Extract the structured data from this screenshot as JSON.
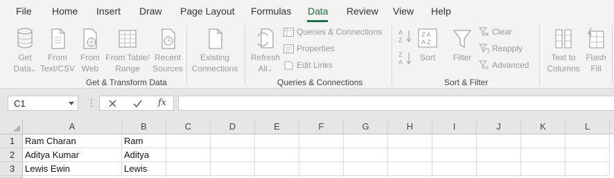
{
  "menu": {
    "tabs": [
      "File",
      "Home",
      "Insert",
      "Draw",
      "Page Layout",
      "Formulas",
      "Data",
      "Review",
      "View",
      "Help"
    ],
    "active": "Data"
  },
  "ribbon": {
    "get_transform": {
      "get_data": [
        "Get",
        "Data"
      ],
      "from_text_csv": [
        "From",
        "Text/CSV"
      ],
      "from_web": [
        "From",
        "Web"
      ],
      "from_table_range": [
        "From Table/",
        "Range"
      ],
      "recent_sources": [
        "Recent",
        "Sources"
      ],
      "existing_connections": [
        "Existing",
        "Connections"
      ],
      "label": "Get & Transform Data"
    },
    "queries": {
      "refresh_all": [
        "Refresh",
        "All"
      ],
      "queries_connections": "Queries & Connections",
      "properties": "Properties",
      "edit_links": "Edit Links",
      "label": "Queries & Connections"
    },
    "sort_filter": {
      "sort": "Sort",
      "filter": "Filter",
      "clear": "Clear",
      "reapply": "Reapply",
      "advanced": "Advanced",
      "label": "Sort & Filter"
    },
    "data_tools": {
      "text_to_columns": [
        "Text to",
        "Columns"
      ],
      "flash_fill": [
        "Flash",
        "Fill"
      ]
    }
  },
  "formula_bar": {
    "name_box": "C1",
    "fx": "fx",
    "value": ""
  },
  "sheet": {
    "columns": [
      "A",
      "B",
      "C",
      "D",
      "E",
      "F",
      "G",
      "H",
      "I",
      "J",
      "K",
      "L"
    ],
    "rows": [
      {
        "num": "1",
        "cells": [
          "Ram Charan",
          "Ram"
        ]
      },
      {
        "num": "2",
        "cells": [
          "Aditya Kumar",
          "Aditya"
        ]
      },
      {
        "num": "3",
        "cells": [
          "Lewis Ewin",
          "Lewis"
        ]
      }
    ]
  },
  "colors": {
    "accent": "#1e6e3f",
    "disabled_text": "#9a9a9a",
    "ribbon_bg": "#f3f3f3"
  }
}
